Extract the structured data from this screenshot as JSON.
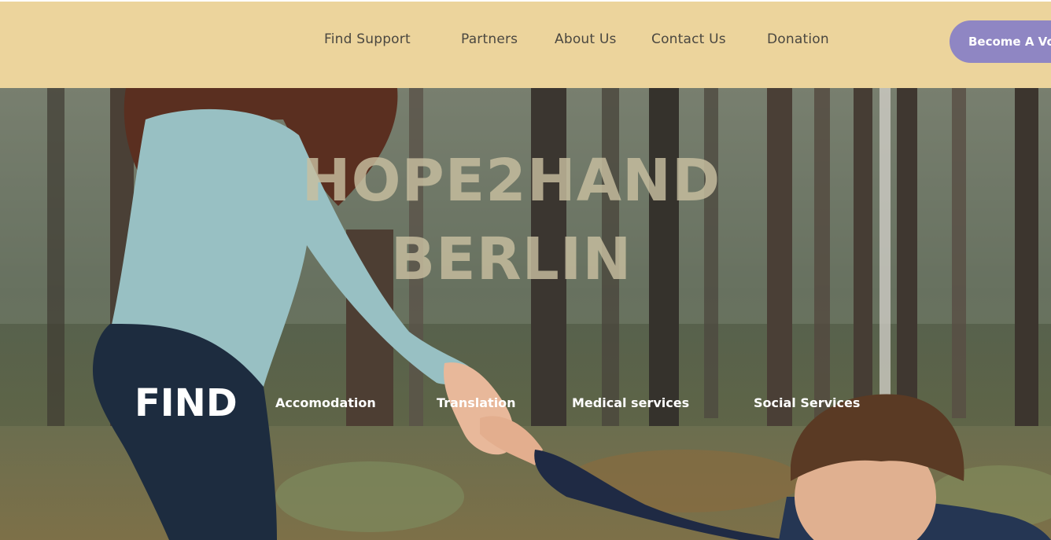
{
  "header": {
    "nav": [
      "Find Support",
      "Partners",
      "About Us",
      "Contact Us",
      "Donation"
    ],
    "cta_label": "Become A Volunteer"
  },
  "hero": {
    "title_line1": "HOPE2HAND",
    "title_line2": "BERLIN",
    "find_label": "FIND",
    "services": [
      "Accomodation",
      "Translation",
      "Medical services",
      "Social Services"
    ]
  },
  "colors": {
    "header_bg": "#ecd49c",
    "cta_bg": "#8f86c3"
  }
}
